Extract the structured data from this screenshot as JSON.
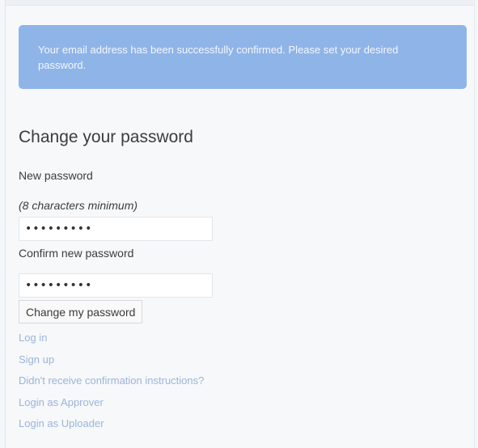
{
  "alert": {
    "message": "Your email address has been successfully confirmed. Please set your desired password."
  },
  "form": {
    "title": "Change your password",
    "new_password_label": "New password",
    "min_hint": "(8 characters minimum)",
    "new_password_value": "•••••••••",
    "confirm_label": "Confirm new password",
    "confirm_value": "•••••••••",
    "submit_label": "Change my password"
  },
  "links": {
    "log_in": "Log in",
    "sign_up": "Sign up",
    "confirmation": "Didn't receive confirmation instructions?",
    "login_approver": "Login as Approver",
    "login_uploader": "Login as Uploader"
  },
  "colors": {
    "alert_bg": "#8fb4e8",
    "link": "#9cb5d8"
  }
}
